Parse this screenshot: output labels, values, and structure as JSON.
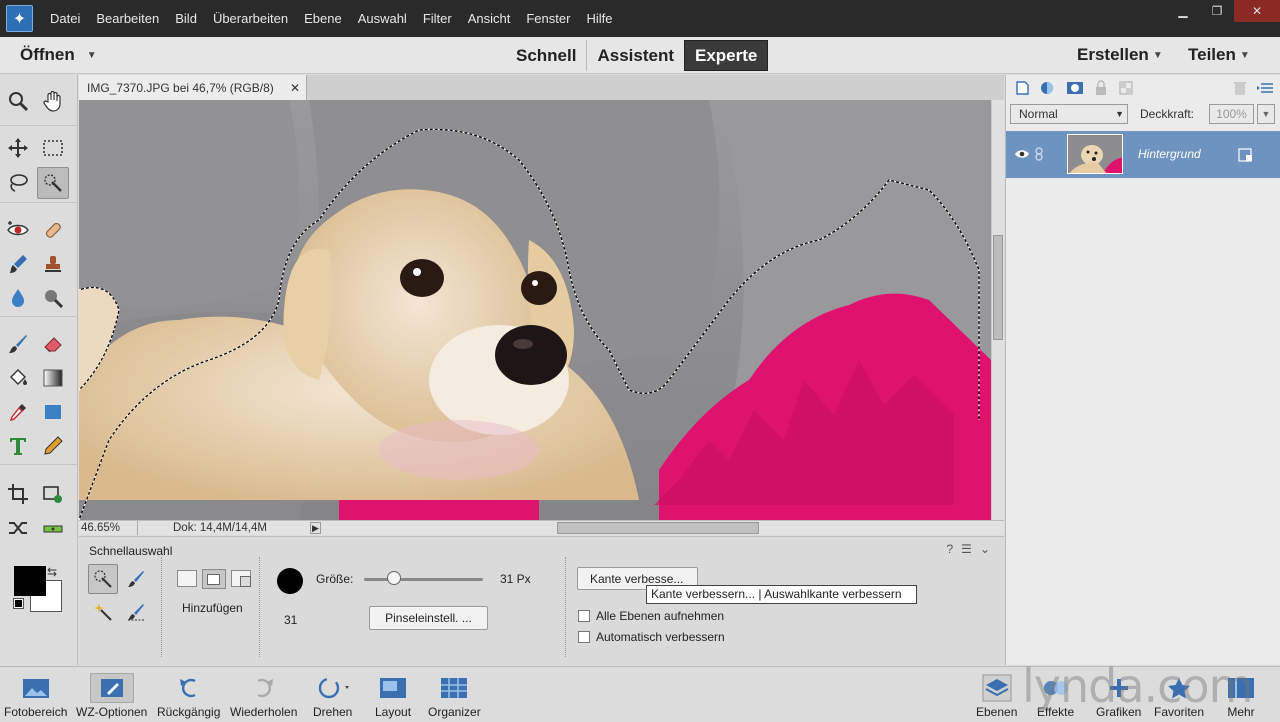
{
  "menubar": {
    "items": [
      "Datei",
      "Bearbeiten",
      "Bild",
      "Überarbeiten",
      "Ebene",
      "Auswahl",
      "Filter",
      "Ansicht",
      "Fenster",
      "Hilfe"
    ]
  },
  "modebar": {
    "open_label": "Öffnen",
    "tabs": [
      "Schnell",
      "Assistent",
      "Experte"
    ],
    "active_tab": "Experte",
    "create_label": "Erstellen",
    "share_label": "Teilen"
  },
  "document": {
    "tab_title": "IMG_7370.JPG bei 46,7% (RGB/8)",
    "zoom": "46.65%",
    "doc_size": "Dok: 14,4M/14,4M"
  },
  "tool_options": {
    "title": "Schnellauswahl",
    "mode_label": "Hinzufügen",
    "size_label": "Größe:",
    "size_value": "31 Px",
    "brush_size": "31",
    "size_slider_fraction": 0.25,
    "brush_settings_btn": "Pinseleinstell. ...",
    "refine_edge_btn": "Kante verbesse...",
    "tooltip": "Kante verbessern... | Auswahlkante verbessern",
    "checkbox_all_layers": "Alle Ebenen aufnehmen",
    "checkbox_auto_enhance": "Automatisch verbessern"
  },
  "layers_panel": {
    "blend_mode": "Normal",
    "opacity_label": "Deckkraft:",
    "opacity_value": "100%",
    "layer_name": "Hintergrund"
  },
  "bottombar": {
    "left": [
      "Fotobereich",
      "WZ-Optionen",
      "Rückgängig",
      "Wiederholen",
      "Drehen",
      "Layout",
      "Organizer"
    ],
    "right": [
      "Ebenen",
      "Effekte",
      "Grafiken",
      "Favoriten",
      "Mehr"
    ]
  },
  "watermark": "lynda.com",
  "colors": {
    "accent_pink": "#e0126f",
    "layer_selected": "#6f93bf",
    "menubar_bg": "#2a2a2a"
  }
}
